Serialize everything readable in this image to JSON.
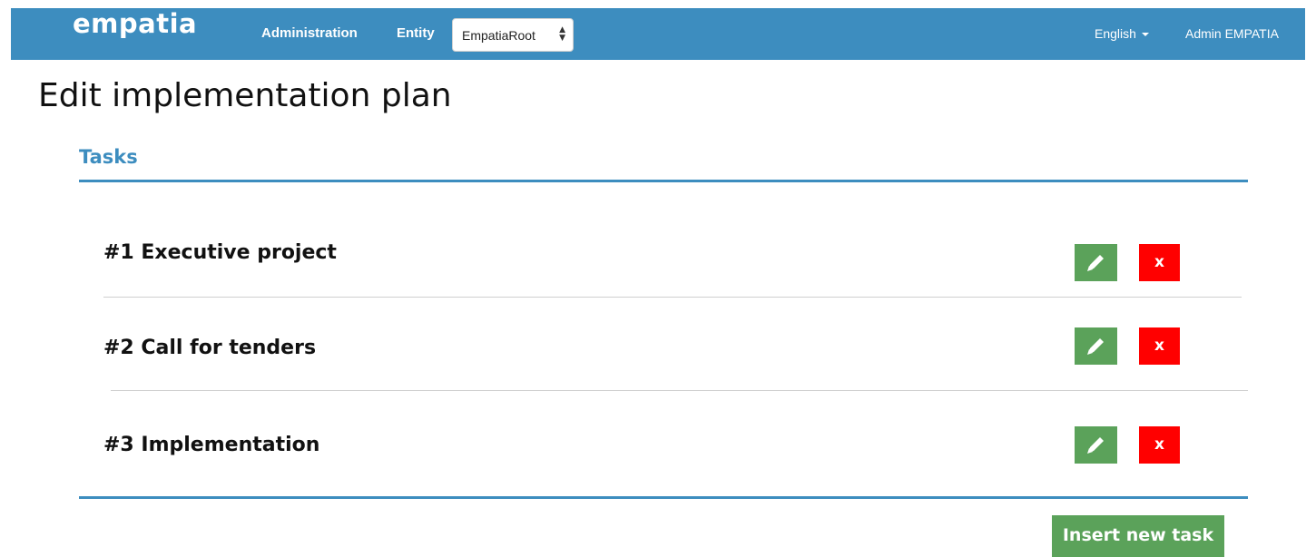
{
  "navbar": {
    "brand": "empatia",
    "links": [
      "Administration",
      "Entity"
    ],
    "entity_select": {
      "value": "EmpatiaRoot"
    },
    "language": "English",
    "user": "Admin EMPATIA",
    "color": "#3d8dbf"
  },
  "page": {
    "title": "Edit implementation plan"
  },
  "tasks_section": {
    "title": "Tasks",
    "items": [
      {
        "label": "#1 Executive project"
      },
      {
        "label": "#2 Call for tenders"
      },
      {
        "label": "#3 Implementation"
      }
    ],
    "edit_icon": "pencil-icon",
    "delete_label": "x",
    "insert_label": "Insert new task",
    "edit_color": "#5ba25a",
    "delete_color": "#ff0000"
  }
}
